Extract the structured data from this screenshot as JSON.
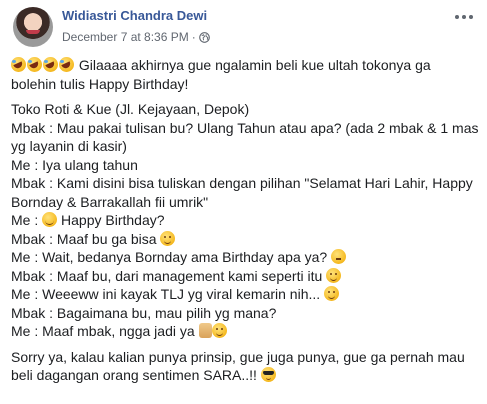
{
  "post": {
    "author": "Widiastri Chandra Dewi",
    "timestamp": "December 7 at 8:36 PM",
    "separator": "·",
    "privacy_icon": "globe-icon",
    "more_icon": "more-options-icon",
    "intro": "Gilaaaa akhirnya gue ngalamin beli kue ultah tokonya ga bolehin tulis Happy Birthday!",
    "intro_emojis": [
      "rofl-emoji",
      "rofl-emoji",
      "rofl-emoji",
      "rofl-emoji"
    ],
    "lines": [
      "Toko Roti & Kue (Jl. Kejayaan, Depok)",
      "Mbak : Mau pakai tulisan bu? Ulang Tahun atau apa? (ada 2 mbak & 1 mas yg layanin di kasir)",
      "Me : Iya ulang tahun",
      "Mbak : Kami disini bisa tuliskan dengan pilihan \"Selamat Hari Lahir, Happy Bornday & Barrakallah fii umrik\"",
      "Me :",
      "Happy Birthday?",
      "Mbak : Maaf bu ga bisa",
      "Me : Wait, bedanya Bornday ama Birthday apa ya?",
      "Mbak : Maaf bu, dari management kami seperti itu",
      "Me : Weeeww ini kayak TLJ yg viral kemarin nih...",
      "Mbak : Bagaimana bu, mau pilih yg mana?",
      "Me : Maaf mbak, ngga jadi ya"
    ],
    "closing": "Sorry ya, kalau kalian punya prinsip, gue juga punya, gue ga pernah mau beli dagangan orang sentimen SARA..!!"
  }
}
